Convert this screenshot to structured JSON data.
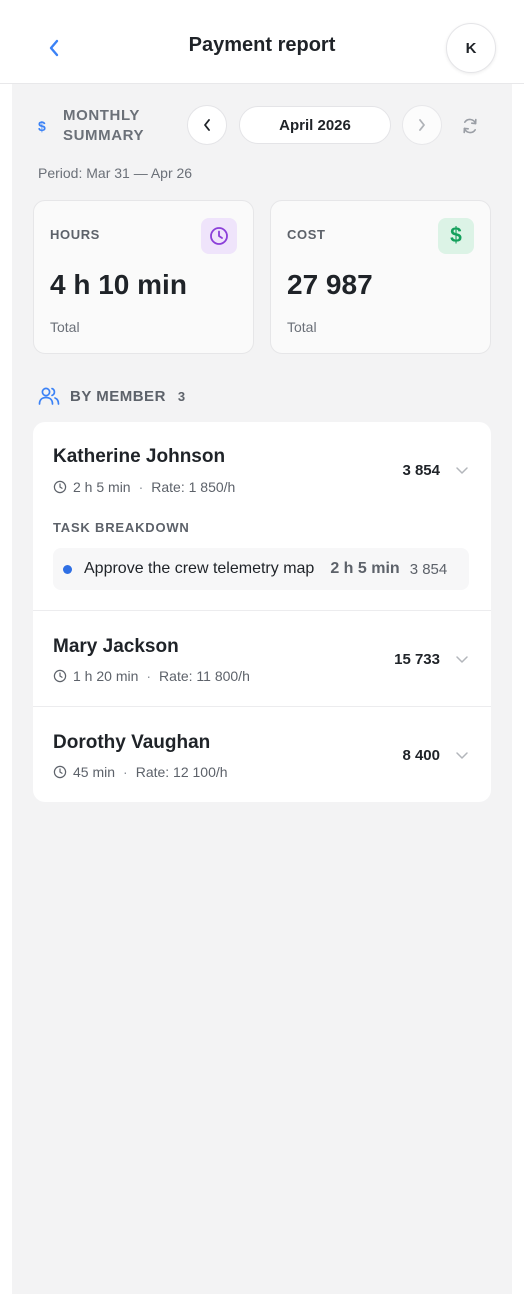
{
  "header": {
    "title": "Payment report",
    "avatar_initial": "K"
  },
  "summary": {
    "label": "MONTHLY\nSUMMARY",
    "month": "April 2026",
    "period": "Period: Mar 31 — Apr 26"
  },
  "stats": {
    "hours": {
      "label": "HOURS",
      "value": "4 h 10 min",
      "sub": "Total",
      "icon": "clock-icon",
      "icon_color": "#8b3fd9"
    },
    "cost": {
      "label": "COST",
      "value": "27 987",
      "sub": "Total",
      "icon": "dollar-icon",
      "icon_symbol": "$",
      "icon_color": "#14a05c"
    }
  },
  "members_section": {
    "label": "BY MEMBER",
    "count": "3"
  },
  "members": [
    {
      "name": "Katherine Johnson",
      "time": "2 h 5 min",
      "rate": "Rate: 1 850/h",
      "amount": "3 854",
      "expanded": true,
      "breakdown_title": "TASK BREAKDOWN",
      "tasks": [
        {
          "name": "Approve the crew telemetry map",
          "time": "2 h 5 min",
          "cost": "3 854"
        }
      ]
    },
    {
      "name": "Mary Jackson",
      "time": "1 h 20 min",
      "rate": "Rate: 11 800/h",
      "amount": "15 733",
      "expanded": false
    },
    {
      "name": "Dorothy Vaughan",
      "time": "45 min",
      "rate": "Rate: 12 100/h",
      "amount": "8 400",
      "expanded": false
    }
  ],
  "colors": {
    "accent": "#3b82f6",
    "background": "#f3f3f4",
    "text": "#1f2328",
    "muted": "#6b7078",
    "task_bullet": "#2f6fe4"
  }
}
